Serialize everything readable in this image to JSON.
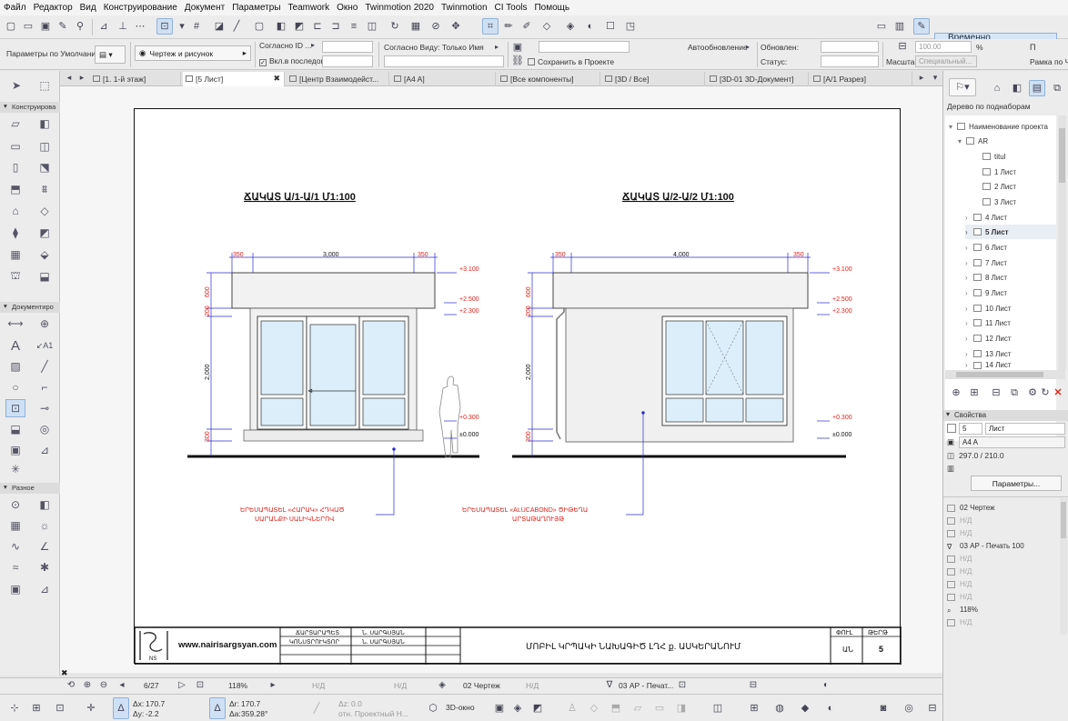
{
  "menu": [
    "Файл",
    "Редактор",
    "Вид",
    "Конструирование",
    "Документ",
    "Параметры",
    "Teamwork",
    "Окно",
    "Twinmotion 2020",
    "Twinmotion",
    "CI Tools",
    "Помощь"
  ],
  "toolbar": {
    "regroup_label": "Временно Разгруппировать",
    "defaults_label": "Параметры по Умолчанию",
    "drawing_mode": "Чертеж и рисунок",
    "by_id_label": "Согласно ID ...",
    "by_view_label": "Согласно Виду: Только Имя",
    "sequential_id": "Вкл.в последователь. ID",
    "save_in_project": "Сохранить в Проекте",
    "autoupdate_label": "Автообновление",
    "updated_label": "Обновлен:",
    "status_label": "Статус:",
    "scale_label": "Масштаб",
    "scale_value": "100.00",
    "scale_unit": "%",
    "special_label": "Специальный...",
    "frame_label": "Рамка по Ч",
    "print_label": "П"
  },
  "tabs": [
    {
      "label": "[1. 1-й этаж]",
      "active": false
    },
    {
      "label": "[5 Лист]",
      "active": true
    },
    {
      "label": "[Центр Взаимодейст...",
      "active": false
    },
    {
      "label": "[A4 A]",
      "active": false
    },
    {
      "label": "[Все компоненты]",
      "active": false
    },
    {
      "label": "[3D / Все]",
      "active": false
    },
    {
      "label": "[3D-01 3D-Документ]",
      "active": false
    },
    {
      "label": "[A/1 Разрез]",
      "active": false
    }
  ],
  "toolbox": {
    "sections": [
      "Конструирова",
      "Документиро",
      "Разное"
    ]
  },
  "drawing": {
    "left_title": "ՃԱԿԱՏ Ա/1-Ա/1 Մ1:100",
    "right_title": "ՃԱԿԱՏ Ա/2-Ա/2 Մ1:100",
    "left_dims": [
      "350",
      "3,000",
      "350"
    ],
    "right_dims": [
      "350",
      "4,000",
      "350"
    ],
    "vert_dims": [
      "600",
      "200",
      "2,000",
      "300"
    ],
    "levels": [
      "+3.100",
      "+2.500",
      "+2.300",
      "+0.300",
      "±0.000"
    ],
    "note_left_1": "ԵՐԵՍԱՊԱՏԵԼ «ՀԱՐԱԿ» ՀԴԿԱԾ",
    "note_left_2": "ՍԱՐԱՆՔԻ ՍԱԼԻԿՆԵՐՈՎ",
    "note_right_1": "ԵՐԵՍԱՊԱՏԵԼ «ALUCABOND» ԾԻԹԵՂԱ",
    "note_right_2": "ԱՐՏԱԹԱՂՈՒՅԹ",
    "stamp_site": "www.nairisargsyan.com",
    "stamp_role1": "ՃԱՐՏԱՐԱՊԵՏ",
    "stamp_role2": "ԿՈՆՍՏՐՈՒԿՏՈՐ",
    "stamp_name1": "Ն. ՍԱՐԳՍՅԱՆ",
    "stamp_name2": "Ն. ՍԱՐԳՍՅԱՆ",
    "stamp_title": "ՄՈԲԻԼ ԿՐՊԱԿԻ ՆԱԽԱԳԻԾ ԼՂՀ ք. ԱՍԿԵՐԱՆՈՒՄ",
    "stamp_phase_h": "ՓՈՒԼ",
    "stamp_phase_v": "ԱՆ",
    "stamp_sheet_h": "ԹԵՐԹ",
    "stamp_sheet_v": "5"
  },
  "navbar": {
    "page": "6/27",
    "zoom": "118%",
    "nd1": "Н/Д",
    "nd2": "Н/Д",
    "nd3": "Н/Д",
    "layer_combo": "02 Чертеж",
    "pen_set": "03 АР - Печат..."
  },
  "coords": {
    "dx_label": "Δx:",
    "dx": "170.7",
    "dy_label": "Δy:",
    "dy": "-2.2",
    "dr_label": "Δr:",
    "dr": "170.7",
    "da_label": "Δa:",
    "da": "359.28°",
    "dz_label": "Δz:",
    "dz": "0.0",
    "ref": "отн. Проектный Н...",
    "view3d": "3D-окно"
  },
  "navigator": {
    "mode": "Дерево по поднаборам",
    "root": "Наименование проекта",
    "folder": "AR",
    "items": [
      "titul",
      "1 Лист",
      "2 Лист",
      "3 Лист",
      "4 Лист",
      "5 Лист",
      "6 Лист",
      "7 Лист",
      "8 Лист",
      "9 Лист",
      "10 Лист",
      "11 Лист",
      "12 Лист",
      "13 Лист",
      "14 Лист"
    ],
    "active_item": "5 Лист"
  },
  "properties": {
    "header": "Свойства",
    "number": "5",
    "name": "Лист",
    "size": "A4 A",
    "dimensions": "297.0 / 210.0",
    "params_button": "Параметры...",
    "rows": [
      "02 Чертеж",
      "Н/Д",
      "Н/Д",
      "03 АР - Печать 100",
      "Н/Д",
      "Н/Д",
      "Н/Д",
      "Н/Д",
      "118%",
      "Н/Д"
    ]
  }
}
